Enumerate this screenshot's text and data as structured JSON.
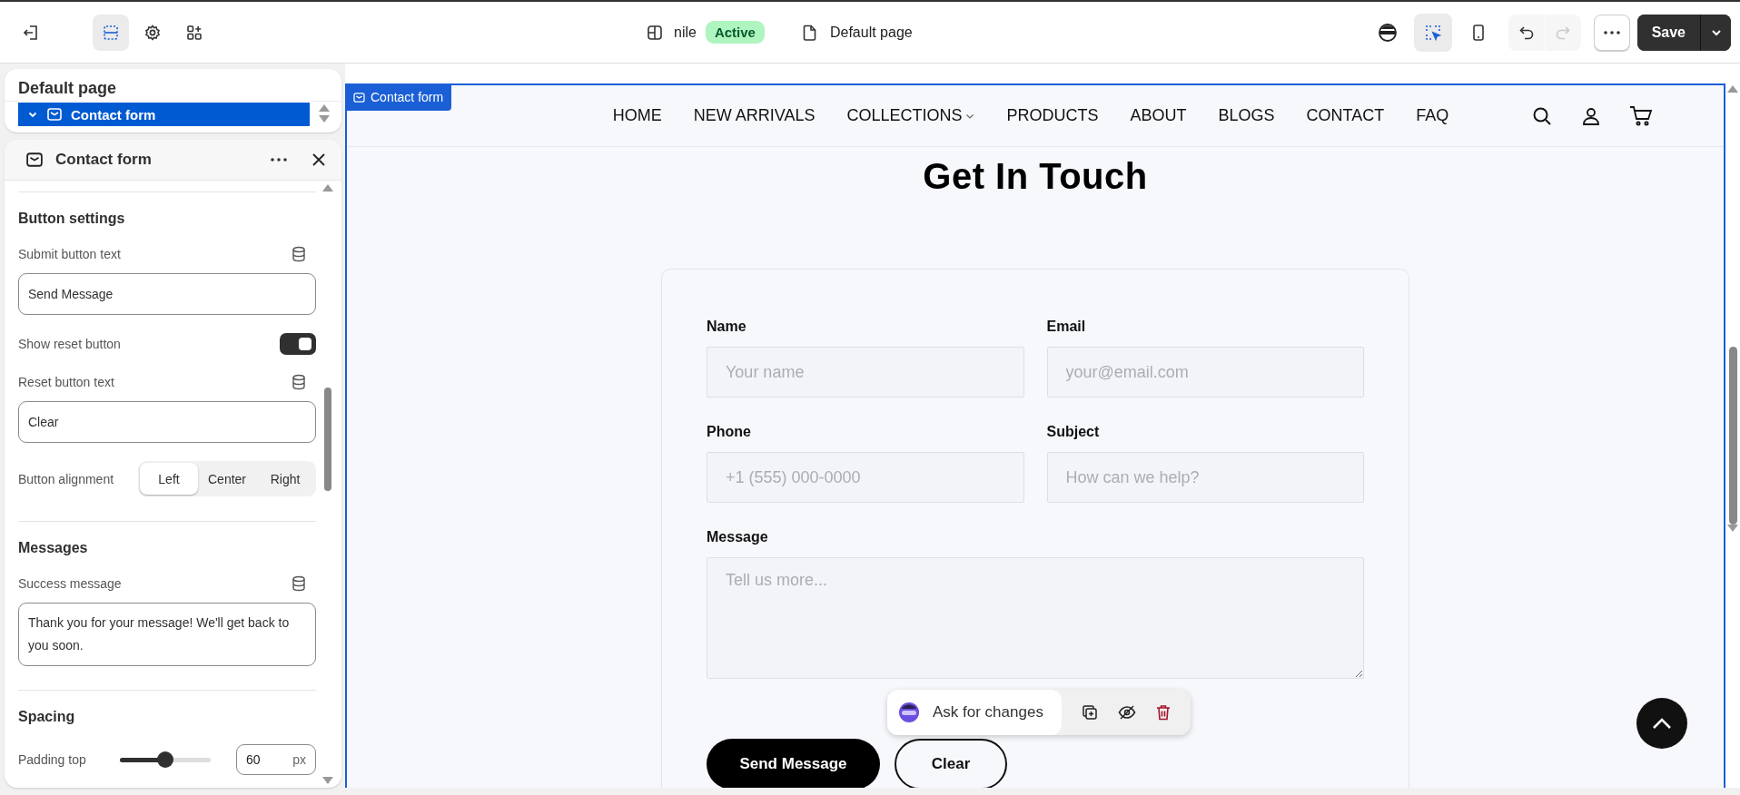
{
  "topbar": {
    "left_tools": [
      {
        "kind": "exit",
        "selected": false
      },
      {
        "kind": "sections",
        "selected": true
      },
      {
        "kind": "settings",
        "selected": false
      },
      {
        "kind": "apps",
        "selected": false
      }
    ],
    "site": {
      "name": "nile",
      "status": "Active"
    },
    "page": "Default page",
    "right_tools": [
      {
        "kind": "avatar",
        "selected": false
      },
      {
        "kind": "select",
        "selected": true
      },
      {
        "kind": "mobile",
        "selected": false
      }
    ],
    "history": [
      {
        "kind": "undo",
        "disabled": false
      },
      {
        "kind": "redo",
        "disabled": true
      }
    ],
    "save": "Save"
  },
  "sidebar": {
    "title": "Default page",
    "tree": [
      {
        "label": "Contact form",
        "expanded": true,
        "selected": true
      }
    ]
  },
  "panel": {
    "title": "Contact form",
    "sections": [
      {
        "title": "Button settings",
        "fields": [
          {
            "kind": "text",
            "label": "Submit button text",
            "value": "Send Message"
          },
          {
            "kind": "toggle",
            "label": "Show reset button",
            "on": true
          },
          {
            "kind": "text",
            "label": "Reset button text",
            "value": "Clear"
          },
          {
            "kind": "segmented",
            "label": "Button alignment",
            "options": [
              {
                "label": "Left",
                "selected": true
              },
              {
                "label": "Center",
                "selected": false
              },
              {
                "label": "Right",
                "selected": false
              }
            ]
          }
        ]
      },
      {
        "title": "Messages",
        "fields": [
          {
            "kind": "textarea",
            "label": "Success message",
            "value": "Thank you for your message! We'll get back to you soon."
          }
        ]
      },
      {
        "title": "Spacing",
        "fields": [
          {
            "kind": "slider",
            "label": "Padding top",
            "level": 0.5,
            "value": "60",
            "unit": "px"
          }
        ]
      }
    ]
  },
  "canvas": {
    "selection_label": "Contact form",
    "nav": [
      {
        "label": "HOME",
        "dropdown": false
      },
      {
        "label": "NEW ARRIVALS",
        "dropdown": false
      },
      {
        "label": "COLLECTIONS",
        "dropdown": true
      },
      {
        "label": "PRODUCTS",
        "dropdown": false
      },
      {
        "label": "ABOUT",
        "dropdown": false
      },
      {
        "label": "BLOGS",
        "dropdown": false
      },
      {
        "label": "CONTACT",
        "dropdown": false
      },
      {
        "label": "FAQ",
        "dropdown": false
      }
    ],
    "heading": "Get In Touch",
    "form": {
      "fields": [
        {
          "kind": "input",
          "label": "Name",
          "placeholder": "Your name"
        },
        {
          "kind": "input",
          "label": "Email",
          "placeholder": "your@email.com"
        },
        {
          "kind": "input",
          "label": "Phone",
          "placeholder": "+1 (555) 000-0000"
        },
        {
          "kind": "input",
          "label": "Subject",
          "placeholder": "How can we help?"
        },
        {
          "kind": "textarea",
          "label": "Message",
          "placeholder": "Tell us more..."
        }
      ],
      "buttons": [
        {
          "kind": "primary",
          "label": "Send Message"
        },
        {
          "kind": "secondary",
          "label": "Clear"
        }
      ]
    },
    "toolbar": {
      "prompt": "Ask for changes"
    }
  }
}
